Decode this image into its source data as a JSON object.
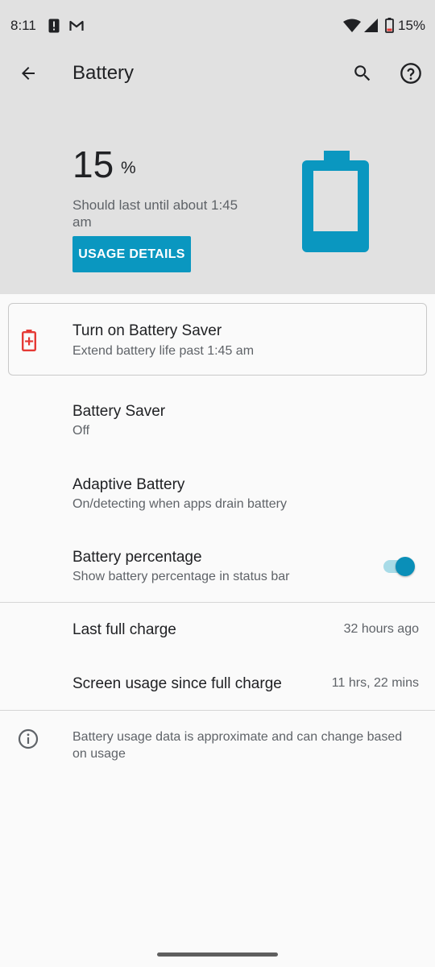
{
  "status_bar": {
    "time": "8:11",
    "battery_pct": "15%"
  },
  "toolbar": {
    "title": "Battery"
  },
  "summary": {
    "level_value": "15",
    "level_unit": "%",
    "estimate": "Should last until about 1:45 am",
    "usage_button_label": "USAGE DETAILS",
    "battery_fill_fraction": 0.15
  },
  "saver_suggestion": {
    "title": "Turn on Battery Saver",
    "subtitle": "Extend battery life past 1:45 am"
  },
  "preferences": [
    {
      "title": "Battery Saver",
      "subtitle": "Off"
    },
    {
      "title": "Adaptive Battery",
      "subtitle": "On/detecting when apps drain battery"
    },
    {
      "title": "Battery percentage",
      "subtitle": "Show battery percentage in status bar",
      "toggle_on": true
    }
  ],
  "stats": [
    {
      "label": "Last full charge",
      "value": "32 hours ago"
    },
    {
      "label": "Screen usage since full charge",
      "value": "11 hrs, 22 mins"
    }
  ],
  "footer_info": "Battery usage data is approximate and can change based on usage",
  "colors": {
    "accent": "#0a97c0",
    "header_bg": "#e1e1e1",
    "warning_red": "#e53935"
  },
  "icons": {
    "status": [
      "alert-icon",
      "gmail-icon",
      "wifi-icon",
      "signal-icon",
      "battery-icon"
    ],
    "toolbar": [
      "back-arrow-icon",
      "search-icon",
      "help-icon"
    ],
    "saver_card": "battery-plus-icon",
    "footer": "info-icon"
  }
}
